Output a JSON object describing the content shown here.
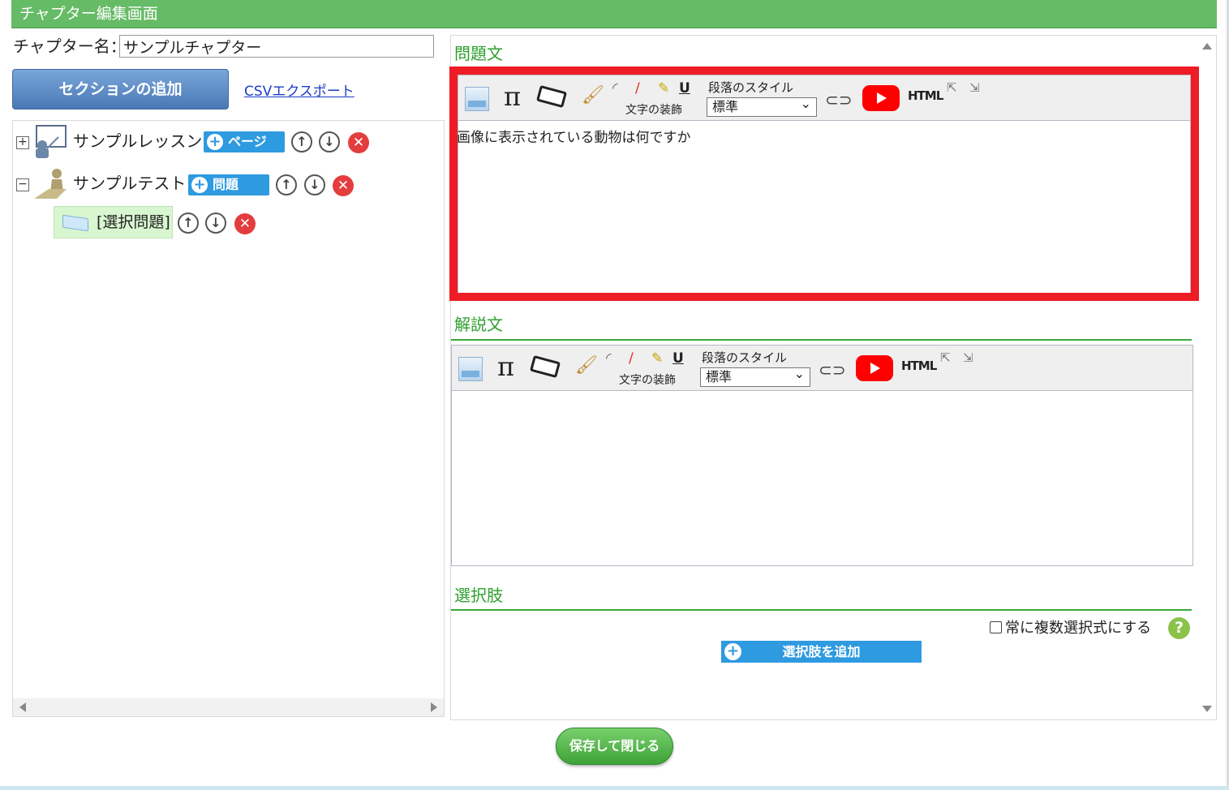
{
  "window": {
    "title": "チャプター編集画面"
  },
  "chapter": {
    "label": "チャプター名：",
    "name_value": "サンプルチャプター"
  },
  "actions": {
    "add_section": "セクションの追加",
    "csv_export": "CSVエクスポート",
    "save_close": "保存して閉じる"
  },
  "tree": {
    "lesson": {
      "expander": "+",
      "label": "サンプルレッスン",
      "add_button": "ページ",
      "up": "↑",
      "down": "↓",
      "delete": "✕"
    },
    "test": {
      "expander": "−",
      "label": "サンプルテスト",
      "add_button": "問題",
      "up": "↑",
      "down": "↓",
      "delete": "✕"
    },
    "question": {
      "label": "[選択問題]",
      "up": "↑",
      "down": "↓",
      "delete": "✕"
    }
  },
  "question_editor": {
    "title": "問題文",
    "toolbar": {
      "pi_glyph": "π",
      "brush_glyph": "🖌",
      "decoration_caption": "文字の装飾",
      "underline_glyph": "U",
      "paragraph_style_label": "段落のスタイル",
      "paragraph_style_value": "標準",
      "link_glyph": "⊂⊃",
      "html_label": "HTML",
      "expand_glyph": "⇱",
      "shrink_glyph": "⇲"
    },
    "body": "画像に表示されている動物は何ですか"
  },
  "explanation_editor": {
    "title": "解説文",
    "toolbar": {
      "pi_glyph": "π",
      "brush_glyph": "🖌",
      "decoration_caption": "文字の装飾",
      "underline_glyph": "U",
      "paragraph_style_label": "段落のスタイル",
      "paragraph_style_value": "標準",
      "link_glyph": "⊂⊃",
      "html_label": "HTML",
      "expand_glyph": "⇱",
      "shrink_glyph": "⇲"
    },
    "body": ""
  },
  "choices": {
    "title": "選択肢",
    "always_multiple_label": "常に複数選択式にする",
    "help_glyph": "?",
    "add_choice": "選択肢を追加",
    "plus_glyph": "+"
  },
  "colors": {
    "title_bar": "#66bb66",
    "section_title": "#2ea02e",
    "highlight_frame": "#ee1c25",
    "action_blue": "#2e9ae0"
  }
}
